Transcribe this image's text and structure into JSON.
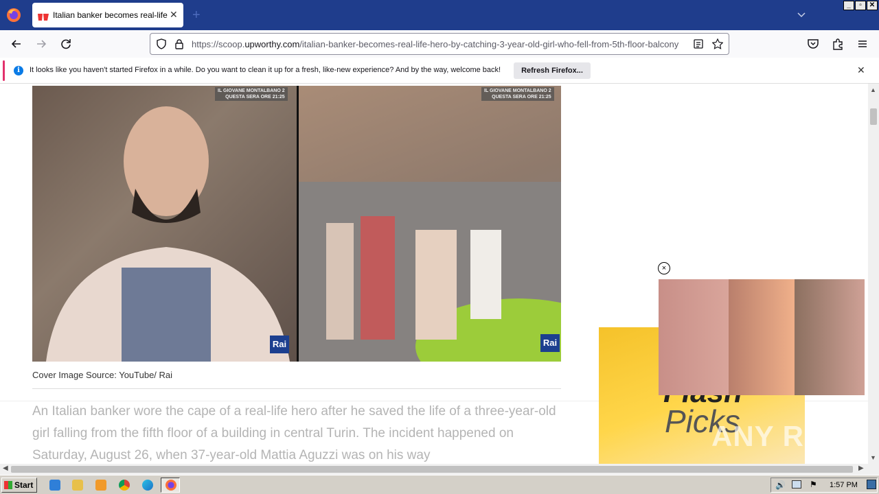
{
  "browser": {
    "tab_title": "Italian banker becomes real-life hero",
    "url_prefix": "https://scoop.",
    "url_domain": "upworthy.com",
    "url_path": "/italian-banker-becomes-real-life-hero-by-catching-3-year-old-girl-who-fell-from-5th-floor-balcony"
  },
  "notification": {
    "message": "It looks like you haven't started Firefox in a while. Do you want to clean it up for a fresh, like-new experience? And by the way, welcome back!",
    "button": "Refresh Firefox..."
  },
  "article": {
    "overlay_line1": "IL GIOVANE MONTALBANO 2",
    "overlay_line2": "QUESTA SERA ORE 21:25",
    "logo": "Rai",
    "caption": "Cover Image Source: YouTube/ Rai",
    "body": "An Italian banker wore the cape of a real-life hero after he saved the life of a three-year-old girl falling from the fifth floor of a building in central Turin. The incident happened on Saturday, August 26, when 37-year-old Mattia Aguzzi was on his way"
  },
  "ad": {
    "line1": "Flash",
    "line2": "Picks",
    "video_close": "×"
  },
  "watermark": "ANY RUN",
  "taskbar": {
    "start": "Start",
    "clock": "1:57 PM"
  },
  "colors": {
    "tabstrip": "#1f3d8c",
    "notice_accent": "#e2316c",
    "info_blue": "#0a7be6"
  }
}
